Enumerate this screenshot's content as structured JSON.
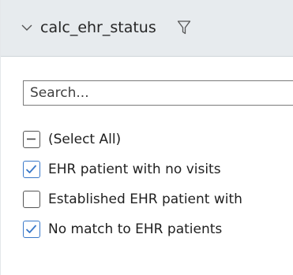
{
  "header": {
    "title": "calc_ehr_status",
    "collapse_icon": "chevron-down-icon",
    "filter_icon": "filter-icon"
  },
  "search": {
    "placeholder": "Search...",
    "value": ""
  },
  "options": [
    {
      "label": "(Select All)",
      "state": "indeterminate"
    },
    {
      "label": "EHR patient with no visits",
      "state": "checked"
    },
    {
      "label": "Established EHR patient with",
      "state": "unchecked"
    },
    {
      "label": "No match to EHR patients",
      "state": "checked"
    }
  ],
  "colors": {
    "header_bg": "#e7ebee",
    "check_accent": "#3a79c9"
  }
}
